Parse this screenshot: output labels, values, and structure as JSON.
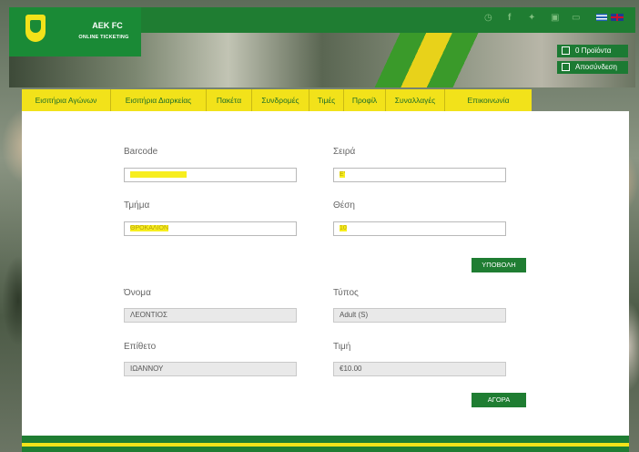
{
  "brand": {
    "title": "AEK FC",
    "subtitle": "ONLINE TICKETING"
  },
  "header": {
    "social_icons": [
      "clock-icon",
      "facebook-icon",
      "twitter-icon",
      "instagram-icon",
      "youtube-icon"
    ],
    "languages": [
      "greek-flag-icon",
      "uk-flag-icon"
    ],
    "cart_label": "0 Προϊόντα",
    "logout_label": "Αποσύνδεση"
  },
  "nav": {
    "items": [
      "Εισιτήρια Αγώνων",
      "Εισιτήρια Διαρκείας",
      "Πακέτα",
      "Συνδρομές",
      "Τιμές",
      "Προφίλ",
      "Συναλλαγές",
      "Επικοινωνία"
    ]
  },
  "form": {
    "barcode_label": "Barcode",
    "barcode_value": "",
    "row_label": "Σειρά",
    "row_value": "Ε'",
    "section_label": "Τμήμα",
    "section_value": "ΘΡΟΚΑΛΙΟΝ",
    "seat_label": "Θέση",
    "seat_value": "10",
    "submit_label": "ΥΠΟΒΟΛΗ",
    "name_label": "Όνομα",
    "name_value": "ΛΕΟΝΤΙΟΣ",
    "type_label": "Τύπος",
    "type_value": "Adult (S)",
    "surname_label": "Επίθετο",
    "surname_value": "ΙΩΑΝΝΟΥ",
    "price_label": "Τιμή",
    "price_value": "€10.00",
    "buy_label": "ΑΓΟΡΑ"
  },
  "colors": {
    "brand_green": "#1f7d32",
    "brand_yellow": "#f2e21a"
  }
}
